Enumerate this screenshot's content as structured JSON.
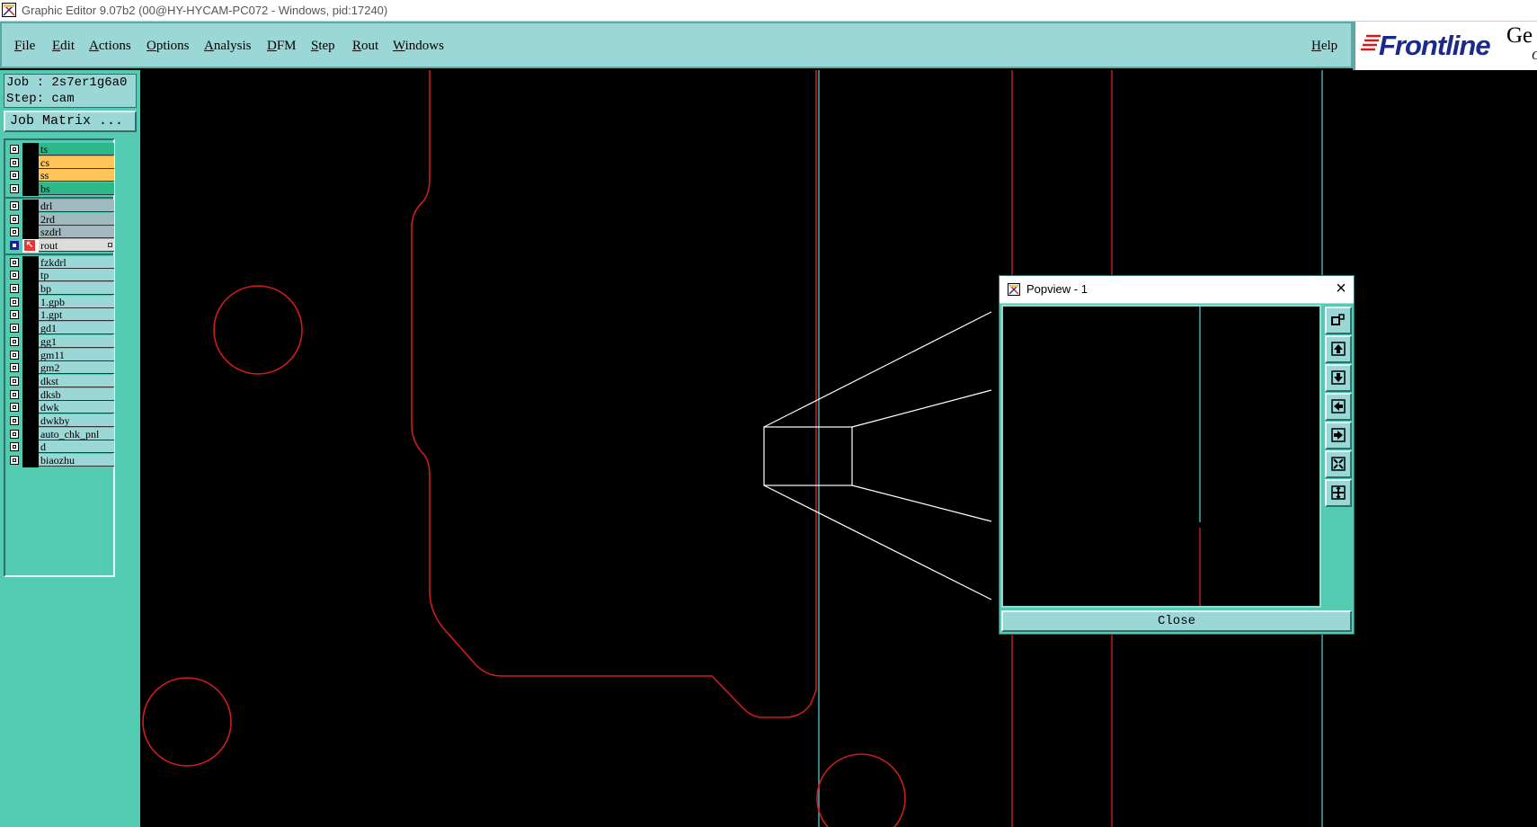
{
  "window": {
    "title": "Graphic Editor 9.07b2 (00@HY-HYCAM-PC072 - Windows, pid:17240)"
  },
  "menu": {
    "items": [
      "File",
      "Edit",
      "Actions",
      "Options",
      "Analysis",
      "DFM",
      "Step",
      "Rout",
      "Windows"
    ],
    "help": "Help"
  },
  "logo": {
    "brand": "Frontline",
    "product_partial": "Ge",
    "tagline_partial": "G"
  },
  "job_info": {
    "job": "Job : 2s7er1g6a0",
    "step": "Step: cam"
  },
  "job_matrix_button": "Job Matrix ...",
  "layers": [
    {
      "name": "ts",
      "color": "#2db88a",
      "group": 1
    },
    {
      "name": "cs",
      "color": "#ffc45a",
      "group": 1
    },
    {
      "name": "ss",
      "color": "#ffc45a",
      "group": 1
    },
    {
      "name": "bs",
      "color": "#2db88a",
      "group": 1
    },
    {
      "name": "drl",
      "color": "#9fb9be",
      "group": 2
    },
    {
      "name": "2rd",
      "color": "#9fb9be",
      "group": 2
    },
    {
      "name": "szdrl",
      "color": "#9fb9be",
      "group": 2
    },
    {
      "name": "rout",
      "color": "#dcdcdc",
      "group": 2,
      "active": true
    },
    {
      "name": "fzkdrl",
      "color": "#9ad7d6",
      "group": 3
    },
    {
      "name": "tp",
      "color": "#9ad7d6",
      "group": 3
    },
    {
      "name": "bp",
      "color": "#9ad7d6",
      "group": 3
    },
    {
      "name": "1.gpb",
      "color": "#9ad7d6",
      "group": 3
    },
    {
      "name": "1.gpt",
      "color": "#9ad7d6",
      "group": 3
    },
    {
      "name": "gd1",
      "color": "#9ad7d6",
      "group": 3
    },
    {
      "name": "gg1",
      "color": "#9ad7d6",
      "group": 3
    },
    {
      "name": "gm11",
      "color": "#9ad7d6",
      "group": 3
    },
    {
      "name": "gm2",
      "color": "#9ad7d6",
      "group": 3
    },
    {
      "name": "dkst",
      "color": "#9ad7d6",
      "group": 3
    },
    {
      "name": "dksb",
      "color": "#9ad7d6",
      "group": 3
    },
    {
      "name": "dwk",
      "color": "#9ad7d6",
      "group": 3
    },
    {
      "name": "dwkby",
      "color": "#9ad7d6",
      "group": 3
    },
    {
      "name": "auto_chk_pnl",
      "color": "#9ad7d6",
      "group": 3
    },
    {
      "name": "d",
      "color": "#9ad7d6",
      "group": 3
    },
    {
      "name": "biaozhu",
      "color": "#9ad7d6",
      "group": 3
    }
  ],
  "popview": {
    "title": "Popview - 1",
    "close_label": "Close",
    "tools": [
      "zoom-home-icon",
      "pan-up-icon",
      "pan-down-icon",
      "pan-left-icon",
      "pan-right-icon",
      "zoom-in-icon",
      "zoom-out-icon"
    ]
  },
  "colors": {
    "panel": "#9ad7d6",
    "sidebar": "#52cbb0",
    "rout_line": "#d01c1c",
    "profile_line": "#46b8c0"
  }
}
